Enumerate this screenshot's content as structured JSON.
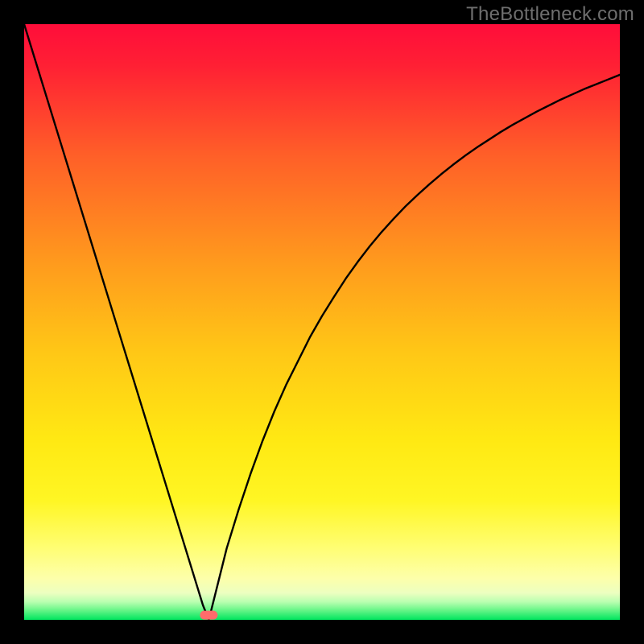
{
  "watermark": "TheBottleneck.com",
  "chart_data": {
    "type": "line",
    "title": "",
    "xlabel": "",
    "ylabel": "",
    "xlim": [
      0,
      100
    ],
    "ylim": [
      0,
      100
    ],
    "background_gradient": {
      "top_color": "#ff0d3a",
      "mid_colors": [
        "#ff5f28",
        "#ffb718",
        "#fff314",
        "#fffe74"
      ],
      "bottom_color": "#00e55e"
    },
    "marker": {
      "x": 31,
      "y": 0.8,
      "color": "#ff6b6b",
      "shape": "rounded-rect"
    },
    "x": [
      0,
      2,
      4,
      6,
      8,
      10,
      12,
      14,
      16,
      18,
      20,
      22,
      24,
      26,
      28,
      29,
      30,
      30.5,
      31,
      31.5,
      32,
      33,
      34,
      36,
      38,
      40,
      42,
      44,
      46,
      48,
      50,
      52,
      54,
      56,
      58,
      60,
      62,
      64,
      66,
      68,
      70,
      72,
      74,
      76,
      78,
      80,
      82,
      84,
      86,
      88,
      90,
      92,
      94,
      96,
      98,
      100
    ],
    "values": [
      100,
      93.5,
      87,
      80.5,
      74,
      67.5,
      61,
      54.5,
      48,
      41.5,
      35,
      28.5,
      22,
      15.5,
      9,
      5.75,
      2.5,
      1.25,
      0,
      2,
      4,
      8,
      12,
      18.5,
      24.5,
      30,
      35,
      39.5,
      43.5,
      47.5,
      51,
      54.2,
      57.3,
      60.1,
      62.7,
      65.1,
      67.3,
      69.4,
      71.3,
      73.1,
      74.8,
      76.4,
      77.9,
      79.3,
      80.6,
      81.9,
      83.1,
      84.2,
      85.3,
      86.3,
      87.3,
      88.2,
      89.1,
      89.9,
      90.7,
      91.5
    ]
  }
}
